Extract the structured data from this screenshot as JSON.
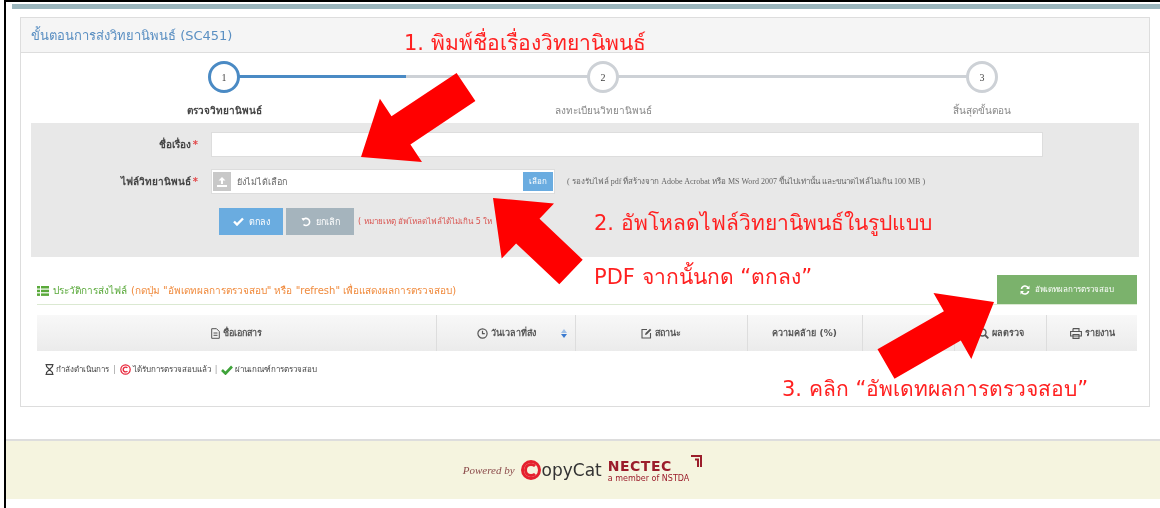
{
  "panel": {
    "title": "ขั้นตอนการส่งวิทยานิพนธ์ (SC451)"
  },
  "steps": [
    {
      "number": "1",
      "label": "ตรวจวิทยานิพนธ์",
      "selected": true
    },
    {
      "number": "2",
      "label": "ลงทะเบียนวิทยานิพนธ์",
      "selected": false
    },
    {
      "number": "3",
      "label": "สิ้นสุดขั้นตอน",
      "selected": false
    }
  ],
  "form": {
    "title_label": "ชื่อเรื่อง",
    "file_label": "ไฟล์วิทยานิพนธ์",
    "required_mark": "*",
    "file_placeholder": "ยังไม่ได้เลือก",
    "browse_button": "เลือก",
    "file_hint": "( รองรับไฟล์ pdf ที่สร้างจาก Adobe Acrobat หรือ MS Word 2007 ขึ้นไปเท่านั้น และขนาดไฟล์ไม่เกิน 100 MB )",
    "ok_button": "ตกลง",
    "cancel_button": "ยกเลิก",
    "note": "( หมายเหตุ อัพโหลดไฟล์ได้ไม่เกิน 5 ให"
  },
  "history": {
    "title": "ประวัติการส่งไฟล์",
    "hint": "(กดปุ่ม \"อัพเดทผลการตรวจสอบ\" หรือ \"refresh\" เพื่อแสดงผลการตรวจสอบ)",
    "update_button": "อัพเดทผลการตรวจสอบ",
    "columns": [
      {
        "label": "ชื่อเอกสาร",
        "kind": "doc"
      },
      {
        "label": "วันเวลาที่ส่ง",
        "kind": "clock"
      },
      {
        "label": "สถานะ",
        "kind": "edit"
      },
      {
        "label": "ความคล้าย (%)",
        "kind": "none"
      },
      {
        "kind": "hidden"
      },
      {
        "label": "ผลตรวจ",
        "kind": "search"
      },
      {
        "label": "รายงาน",
        "kind": "print"
      }
    ],
    "legend_separator": "|",
    "legend": [
      {
        "label": "กำลังดำเนินการ",
        "kind": "hourglass"
      },
      {
        "label": "ได้รับการตรวจสอบแล้ว",
        "kind": "copyright"
      },
      {
        "label": "ผ่านเกณฑ์การตรวจสอบ",
        "kind": "check"
      }
    ]
  },
  "footer": {
    "powered": "Powered by",
    "brand": "opyCat",
    "nectec": "NECTEC",
    "member": "a member of NSTDA"
  },
  "annotations": [
    {
      "text": "1. พิมพ์ชื่อเรื่องวิทยานิพนธ์"
    },
    {
      "text": "2. อัพโหลดไฟล์วิทยานิพนธ์ในรูปแบบ"
    },
    {
      "text": "PDF จากนั้นกด “ตกลง”"
    },
    {
      "text": "3. คลิก “อัพเดทผลการตรวจสอบ”"
    }
  ]
}
